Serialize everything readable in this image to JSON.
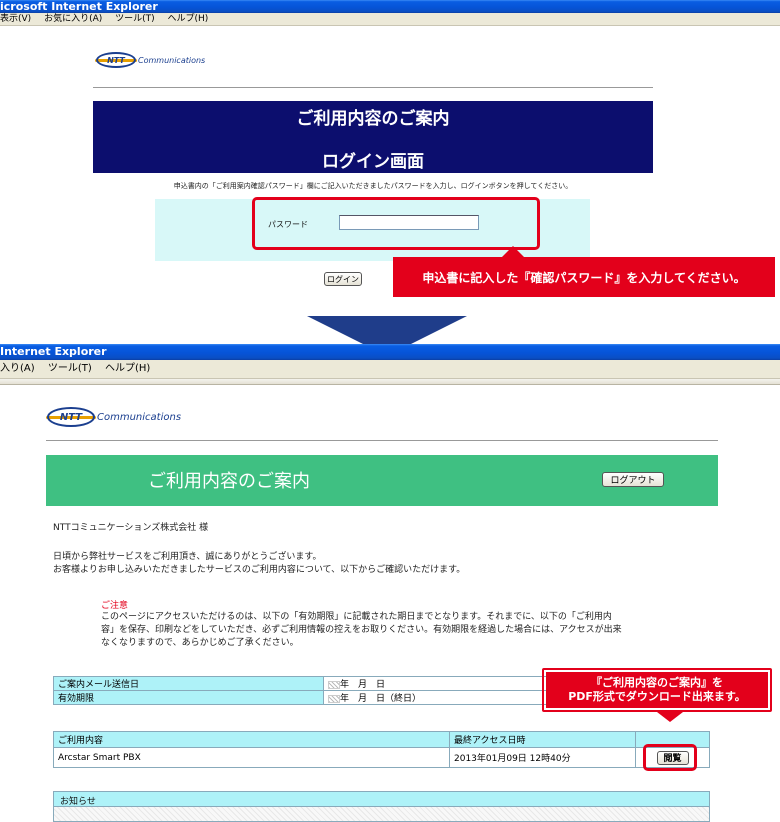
{
  "window1": {
    "title": "icrosoft Internet Explorer",
    "menu": [
      "表示(V)",
      "お気に入り(A)",
      "ツール(T)",
      "ヘルプ(H)"
    ]
  },
  "login": {
    "logo": "NTT Communications",
    "logo_mark": "NTT",
    "logo_word": "Communications",
    "banner_title": "ご利用内容のご案内",
    "banner_subtitle": "ログイン画面",
    "instruction": "申込書内の「ご利用案内確認パスワード」欄にご記入いただきましたパスワードを入力し、ログインボタンを押してください。",
    "password_label": "パスワード",
    "password_value": "",
    "login_button": "ログイン",
    "callout": "申込書に記入した『確認パスワード』を入力してください。"
  },
  "window2": {
    "title": "Internet Explorer",
    "menu": [
      "入り(A)",
      "ツール(T)",
      "ヘルプ(H)"
    ]
  },
  "result": {
    "logo_mark": "NTT",
    "logo_word": "Communications",
    "banner_title": "ご利用内容のご案内",
    "logout_button": "ログアウト",
    "company": "NTTコミュニケーションズ株式会社 様",
    "greeting_1": "日頃から弊社サービスをご利用頂き、誠にありがとうございます。",
    "greeting_2": "お客様よりお申し込みいただきましたサービスのご利用内容について、以下からご確認いただけます。",
    "caution_title": "ご注意",
    "caution_1": "このページにアクセスいただけるのは、以下の「有効期限」に記載された期日までとなります。それまでに、以下の「ご利用内",
    "caution_2": "容」を保存、印刷などをしていただき、必ずご利用情報の控えをお取りください。有効期限を経過した場合には、アクセスが出来",
    "caution_3": "なくなりますので、あらかじめご了承ください。",
    "mail_date_label": "ご案内メール送信日",
    "mail_date_value": "年　月　日",
    "expiry_label": "有効期限",
    "expiry_value": "年　月　日（終日）",
    "service_header": "ご利用内容",
    "last_access_header": "最終アクセス日時",
    "service_name": "Arcstar Smart PBX",
    "last_access_value": "2013年01月09日 12時40分",
    "view_button": "閲覧",
    "notice_header": "お知らせ",
    "callout_line1": "『ご利用内容のご案内』を",
    "callout_line2": "PDF形式でダウンロード出来ます。"
  }
}
